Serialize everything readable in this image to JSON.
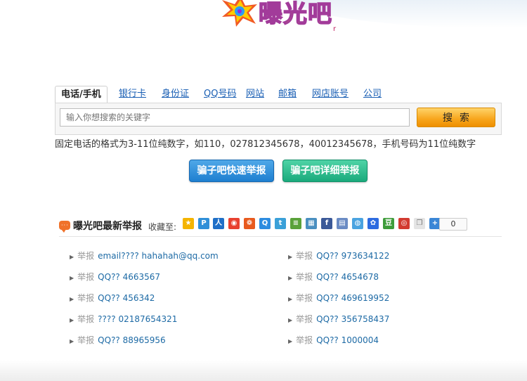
{
  "logo": {
    "text": "曝光吧",
    "mark": "r"
  },
  "search": {
    "tabs": [
      {
        "label": "电话/手机",
        "active": true
      },
      {
        "label": "银行卡"
      },
      {
        "label": "身份证"
      },
      {
        "label": "QQ号码"
      },
      {
        "label": "网站"
      },
      {
        "label": "邮箱"
      },
      {
        "label": "网店账号"
      },
      {
        "label": "公司"
      }
    ],
    "placeholder": "输入你想搜索的关键字",
    "value": "",
    "button_label": "搜索",
    "hint": "固定电话的格式为3-11位纯数字，如110，027812345678，40012345678，手机号码为11位纯数字"
  },
  "actions": {
    "quick_report": "骗子吧快速举报",
    "detail_report": "骗子吧详细举报"
  },
  "latest": {
    "title": "曝光吧最新举报",
    "collect_label": "收藏至:",
    "share_count": "0",
    "share_icons": [
      "qzone-icon",
      "pengyou-icon",
      "renren-icon",
      "weibo-icon",
      "kaixin-icon",
      "qq-icon",
      "tqq-icon",
      "douban9-icon",
      "xianguo-icon",
      "facebook-icon",
      "net163-icon",
      "sohu-icon",
      "baidu-icon",
      "douban-icon",
      "ifeng-icon",
      "copy-icon",
      "more-icon"
    ],
    "reports": [
      {
        "tag": "举报",
        "content": "email???? hahahah@qq.com"
      },
      {
        "tag": "举报",
        "content": "QQ?? 973634122"
      },
      {
        "tag": "举报",
        "content": "QQ?? 4663567"
      },
      {
        "tag": "举报",
        "content": "QQ?? 4654678"
      },
      {
        "tag": "举报",
        "content": "QQ?? 456342"
      },
      {
        "tag": "举报",
        "content": "QQ?? 469619952"
      },
      {
        "tag": "举报",
        "content": "???? 02187654321"
      },
      {
        "tag": "举报",
        "content": "QQ?? 356758437"
      },
      {
        "tag": "举报",
        "content": "QQ?? 88965956"
      },
      {
        "tag": "举报",
        "content": "QQ?? 1000004"
      }
    ]
  },
  "colors": {
    "link": "#1a5fb4",
    "report_text": "#1d6aa5",
    "search_button": "#f7a51c",
    "quick_button": "#1e7fd0",
    "detail_button": "#1aaa7c",
    "logo_text": "#f4d400"
  }
}
